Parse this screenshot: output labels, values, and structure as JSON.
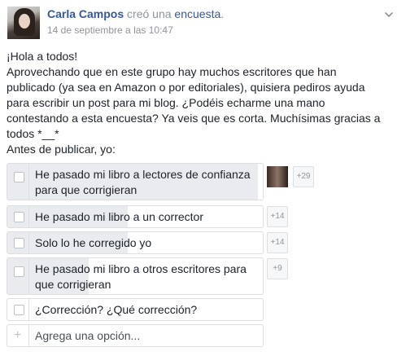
{
  "post": {
    "author": "Carla Campos",
    "action": "creó una",
    "target": "encuesta",
    "period": ".",
    "timestamp": "14 de septiembre a las 10:47",
    "body_lines": [
      "¡Hola a todos!",
      "Aprovechando que en este grupo hay muchos escritores que han",
      "publicado (ya sea en Amazon o por editoriales), quisiera pediros ayuda",
      "para escribir un post para mi blog. ¿Podéis echarme una mano",
      "contestando a esta encuesta? Ya veis que es corta. Muchísimas gracias a",
      "todos *__*",
      "Antes de publicar, yo:"
    ]
  },
  "poll": {
    "options": [
      {
        "line1": "He pasado mi libro a lectores de confianza",
        "line2": "para que corrigieran",
        "votes_label": "+29",
        "share": 0.98,
        "has_voter_thumb": true
      },
      {
        "line1": "He pasado mi libro a un corrector",
        "line2": "",
        "votes_label": "+14",
        "share": 0.47
      },
      {
        "line1": "Solo lo he corregido yo",
        "line2": "",
        "votes_label": "+14",
        "share": 0.47
      },
      {
        "line1": "He pasado mi libro a otros escritores para",
        "line2": "que corrigieran",
        "votes_label": "+9",
        "share": 0.32
      },
      {
        "line1": "¿Corrección? ¿Qué corrección?",
        "line2": "",
        "votes_label": "",
        "share": 0
      }
    ],
    "add_option_placeholder": "Agrega una opción..."
  },
  "colors": {
    "link": "#365899",
    "meta": "#90949c",
    "text": "#1d2129",
    "bar_fill": "#e9ebee",
    "border": "#dddfe2"
  },
  "icons": [
    "chevron-down-icon",
    "checkbox-icon",
    "plus-icon"
  ]
}
